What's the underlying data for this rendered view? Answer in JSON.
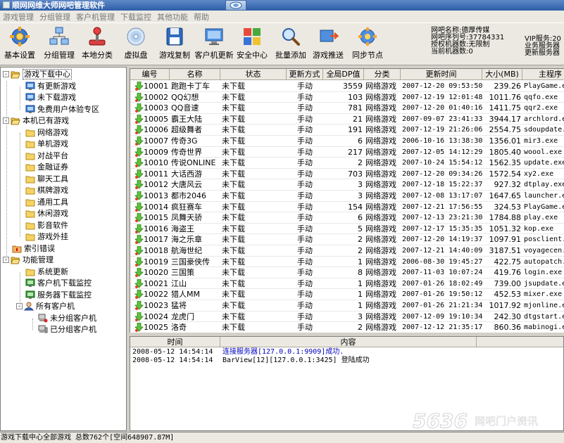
{
  "window": {
    "title": "顺网网维大师网吧管理软件",
    "title_bg": "#2c5ea8"
  },
  "menu": [
    "游戏管理",
    "分组管理",
    "客户机管理",
    "下载监控",
    "其他功能",
    "帮助"
  ],
  "toolbar": {
    "buttons": [
      {
        "label": "基本设置",
        "icon": "gear-icon"
      },
      {
        "label": "分组管理",
        "icon": "network-icon"
      },
      {
        "label": "本地分类",
        "icon": "joystick-icon"
      },
      {
        "label": "虚拟盘",
        "icon": "disc-icon"
      },
      {
        "label": "游戏复制",
        "icon": "floppy-icon"
      },
      {
        "label": "客户机更新",
        "icon": "monitor-icon"
      },
      {
        "label": "安全中心",
        "icon": "shield-icon"
      },
      {
        "label": "批量添加",
        "icon": "magnifier-icon"
      },
      {
        "label": "游戏推送",
        "icon": "push-icon"
      },
      {
        "label": "同步节点",
        "icon": "sync-icon"
      }
    ],
    "info": {
      "line1": "网吧名称:德厚传媒",
      "line2": "网吧序列号:37784331",
      "line3": "授权机器数:无限制",
      "line4": "当前机器数:0",
      "right1": "VIP服务:20",
      "right2": "业务服务器",
      "right3": "更新服务器"
    }
  },
  "tree": [
    {
      "label": "游戏下载中心",
      "level": 0,
      "icon": "folder-open-icon",
      "expander": "-",
      "selected": true
    },
    {
      "label": "有更新游戏",
      "level": 1,
      "icon": "monitor-icon"
    },
    {
      "label": "未下载游戏",
      "level": 1,
      "icon": "monitor-icon"
    },
    {
      "label": "免费用户体验专区",
      "level": 1,
      "icon": "monitor-icon"
    },
    {
      "label": "本机已有游戏",
      "level": 0,
      "icon": "folder-open-icon",
      "expander": "-"
    },
    {
      "label": "网络游戏",
      "level": 1,
      "icon": "folder-icon"
    },
    {
      "label": "单机游戏",
      "level": 1,
      "icon": "folder-icon"
    },
    {
      "label": "对战平台",
      "level": 1,
      "icon": "folder-icon"
    },
    {
      "label": "金融证券",
      "level": 1,
      "icon": "folder-icon"
    },
    {
      "label": "聊天工具",
      "level": 1,
      "icon": "folder-icon"
    },
    {
      "label": "棋牌游戏",
      "level": 1,
      "icon": "folder-icon"
    },
    {
      "label": "通用工具",
      "level": 1,
      "icon": "folder-icon"
    },
    {
      "label": "休闲游戏",
      "level": 1,
      "icon": "folder-icon"
    },
    {
      "label": "影音软件",
      "level": 1,
      "icon": "folder-icon"
    },
    {
      "label": "游戏外挂",
      "level": 1,
      "icon": "folder-icon"
    },
    {
      "label": "索引错误",
      "level": 0,
      "icon": "warning-folder-icon"
    },
    {
      "label": "功能管理",
      "level": 0,
      "icon": "folder-open-icon",
      "expander": "-"
    },
    {
      "label": "系统更新",
      "level": 1,
      "icon": "folder-icon"
    },
    {
      "label": "客户机下载监控",
      "level": 1,
      "icon": "monitor-green-icon"
    },
    {
      "label": "服务器下载监控",
      "level": 1,
      "icon": "monitor-green-icon"
    },
    {
      "label": "所有客户机",
      "level": 1,
      "icon": "user-icon",
      "expander": "-"
    },
    {
      "label": "未分组客户机",
      "level": 2,
      "icon": "computer-red-icon"
    },
    {
      "label": "已分组客户机",
      "level": 2,
      "icon": "computer-icon"
    }
  ],
  "grid": {
    "columns": [
      "编号",
      "名称",
      "状态",
      "更新方式",
      "全局DP值",
      "分类",
      "更新时间",
      "大小(MB)",
      "主程序"
    ],
    "rows": [
      [
        "10001",
        "跑跑卡丁车",
        "未下载",
        "手动",
        "3559",
        "网络游戏",
        "2007-12-20 09:53:50",
        "239.26",
        "PlayGame.exe"
      ],
      [
        "10002",
        "QQ幻想",
        "未下载",
        "手动",
        "103",
        "网络游戏",
        "2007-12-19 12:01:48",
        "1011.76",
        "qqfo.exe"
      ],
      [
        "10003",
        "QQ音速",
        "未下载",
        "手动",
        "781",
        "网络游戏",
        "2007-12-20 01:40:16",
        "1411.75",
        "qqr2.exe"
      ],
      [
        "10005",
        "霸王大陆",
        "未下载",
        "手动",
        "21",
        "网络游戏",
        "2007-09-07 23:41:33",
        "3944.17",
        "archlord.exe"
      ],
      [
        "10006",
        "超级舞者",
        "未下载",
        "手动",
        "191",
        "网络游戏",
        "2007-12-19 21:26:06",
        "2554.75",
        "sdoupdate.exe"
      ],
      [
        "10007",
        "传奇3G",
        "未下载",
        "手动",
        "6",
        "网络游戏",
        "2006-10-16 13:38:30",
        "1356.01",
        "mir3.exe"
      ],
      [
        "10009",
        "传奇世界",
        "未下载",
        "手动",
        "217",
        "网络游戏",
        "2007-12-05 14:12:29",
        "1805.40",
        "woool.exe"
      ],
      [
        "10010",
        "传说ONLINE",
        "未下载",
        "手动",
        "2",
        "网络游戏",
        "2007-10-24 15:54:12",
        "1562.35",
        "update.exe"
      ],
      [
        "10011",
        "大话西游",
        "未下载",
        "手动",
        "703",
        "网络游戏",
        "2007-12-20 09:34:26",
        "1572.54",
        "xy2.exe"
      ],
      [
        "10012",
        "大唐风云",
        "未下载",
        "手动",
        "3",
        "网络游戏",
        "2007-12-18 15:22:37",
        "927.32",
        "dtplay.exe"
      ],
      [
        "10013",
        "都市2046",
        "未下载",
        "手动",
        "3",
        "网络游戏",
        "2007-12-08 13:17:07",
        "1647.65",
        "launcher.exe"
      ],
      [
        "10014",
        "疯狂赛车",
        "未下载",
        "手动",
        "154",
        "网络游戏",
        "2007-12-21 17:56:55",
        "324.53",
        "PlayGame.exe"
      ],
      [
        "10015",
        "凤舞天骄",
        "未下载",
        "手动",
        "6",
        "网络游戏",
        "2007-12-13 23:21:30",
        "1784.88",
        "play.exe"
      ],
      [
        "10016",
        "海盗王",
        "未下载",
        "手动",
        "5",
        "网络游戏",
        "2007-12-17 15:35:35",
        "1051.32",
        "kop.exe"
      ],
      [
        "10017",
        "海之乐章",
        "未下载",
        "手动",
        "2",
        "网络游戏",
        "2007-12-20 14:19:37",
        "1097.91",
        "posclient.exe"
      ],
      [
        "10018",
        "航海世纪",
        "未下载",
        "手动",
        "2",
        "网络游戏",
        "2007-12-21 14:40:09",
        "3187.51",
        "voyagecen.exe"
      ],
      [
        "10019",
        "三国豪侠传",
        "未下载",
        "手动",
        "1",
        "网络游戏",
        "2006-08-30 19:45:27",
        "422.75",
        "autopatch.exe"
      ],
      [
        "10020",
        "三国策",
        "未下载",
        "手动",
        "8",
        "网络游戏",
        "2007-11-03 10:07:24",
        "419.76",
        "login.exe"
      ],
      [
        "10021",
        "江山",
        "未下载",
        "手动",
        "1",
        "网络游戏",
        "2007-01-26 18:02:49",
        "739.00",
        "jsupdate.exe"
      ],
      [
        "10022",
        "猎人MM",
        "未下载",
        "手动",
        "1",
        "网络游戏",
        "2007-01-26 19:50:12",
        "452.53",
        "mixer.exe"
      ],
      [
        "10023",
        "猛将",
        "未下载",
        "手动",
        "1",
        "网络游戏",
        "2007-01-26 21:21:34",
        "1017.92",
        "mjonline.exe"
      ],
      [
        "10024",
        "龙虎门",
        "未下载",
        "手动",
        "3",
        "网络游戏",
        "2007-12-09 19:10:34",
        "242.30",
        "dtgstart.exe"
      ],
      [
        "10025",
        "洛奇",
        "未下载",
        "手动",
        "2",
        "网络游戏",
        "2007-12-12 21:35:17",
        "860.36",
        "mabinogi.exe"
      ]
    ]
  },
  "log": {
    "columns": [
      "时间",
      "内容"
    ],
    "rows": [
      {
        "time": "2008-05-12 14:54:14",
        "content": "连接服务器[127.0.0.1:9909]成功.",
        "color": "#0000c0"
      },
      {
        "time": "2008-05-12 14:54:14",
        "content": "BarView[12][127.0.0.1:3425] 登陆成功",
        "color": "#000000"
      }
    ]
  },
  "status": {
    "text": "游戏下载中心全部游戏 总数762个[空间648907.87M]"
  },
  "watermark": {
    "text": "5636 网吧门户资讯"
  }
}
